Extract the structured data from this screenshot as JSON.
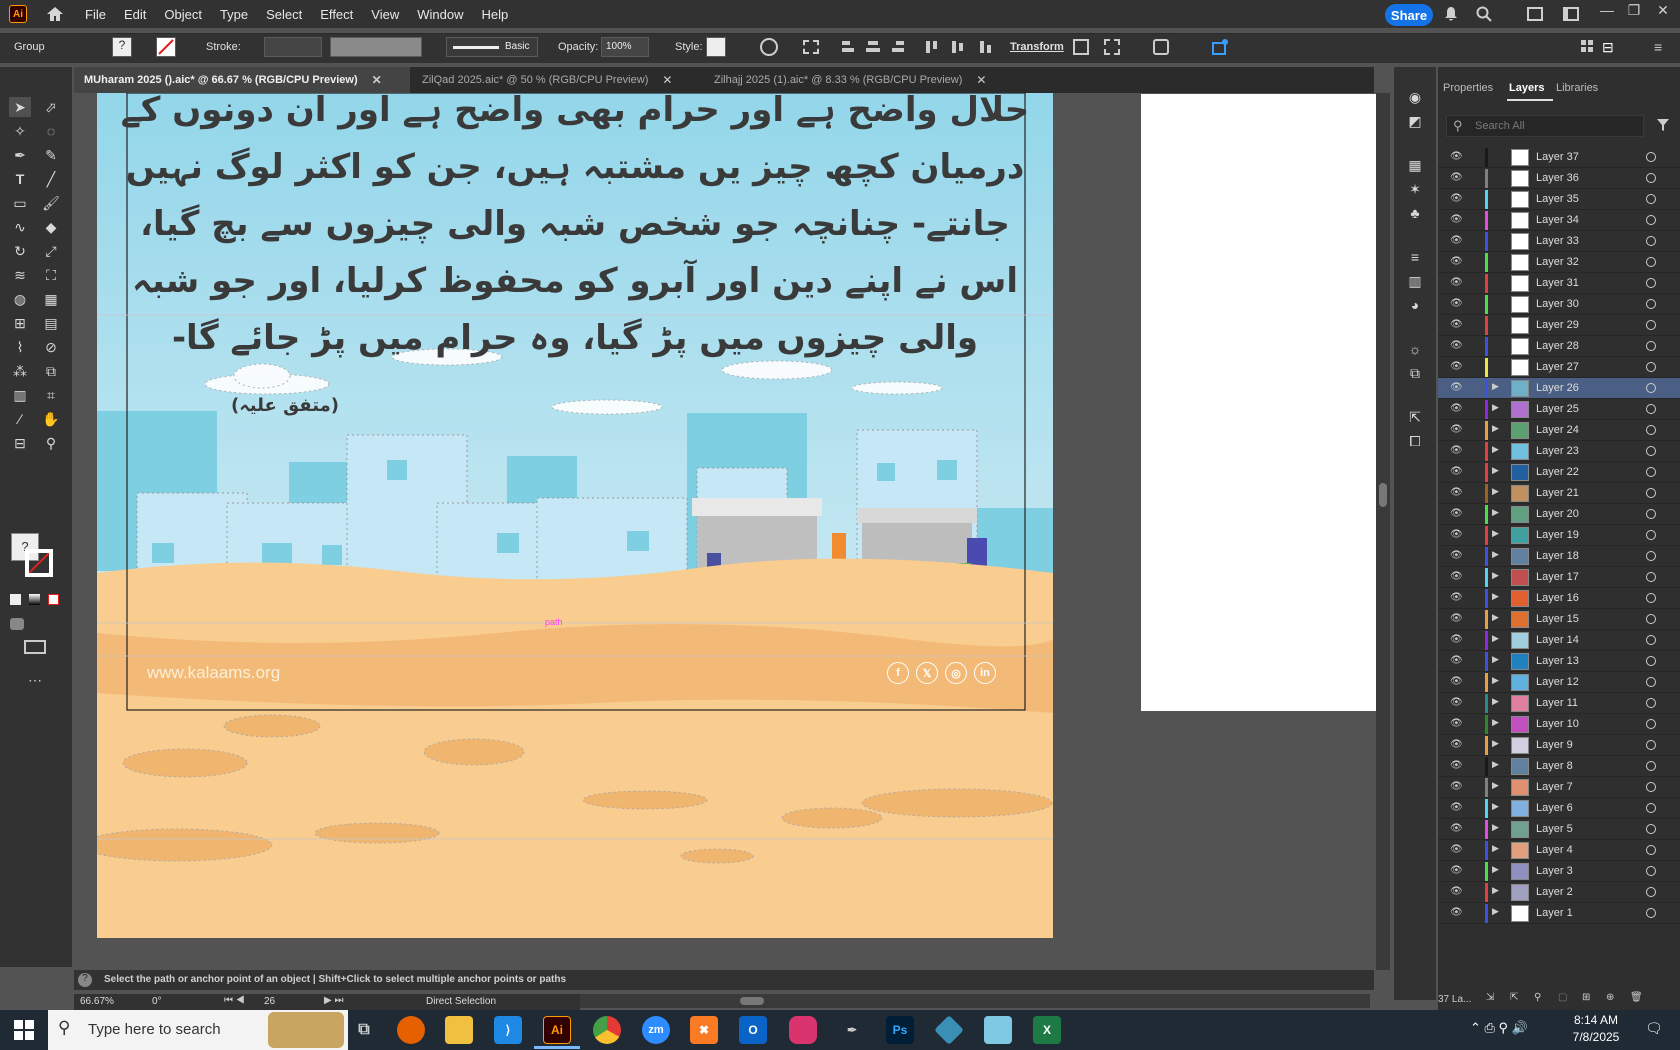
{
  "app": {
    "logo": "Ai",
    "icon": "home-icon"
  },
  "menu": [
    "File",
    "Edit",
    "Object",
    "Type",
    "Select",
    "Effect",
    "View",
    "Window",
    "Help"
  ],
  "share_label": "Share",
  "control": {
    "selection_label": "Group",
    "stroke_label": "Stroke:",
    "brush_label": "Basic",
    "opacity_label": "Opacity:",
    "opacity_value": "100%",
    "style_label": "Style:",
    "transform_label": "Transform"
  },
  "tabs": [
    {
      "label": "MUharam 2025 ().aic* @ 66.67 % (RGB/CPU Preview)",
      "active": true
    },
    {
      "label": "ZilQad 2025.aic* @ 50 % (RGB/CPU Preview)",
      "active": false
    },
    {
      "label": "Zilhajj 2025 (1).aic* @ 8.33 % (RGB/CPU Preview)",
      "active": false
    }
  ],
  "artwork": {
    "lines": [
      "حلال واضح ہے اور حرام بھی واضح ہے اور ان دونوں کے",
      "درمیان کچھ چیز یں مشتبہ ہیں، جن کو اکثر لوگ نہیں",
      "جانتے- چنانچہ جو شخص شبہ والی چیزوں سے بچ گیا،",
      "اس نے اپنے دین اور آبرو کو محفوظ کرلیا، اور جو شبہ",
      "والی چیزوں میں پڑ گیا، وہ حرام میں پڑ جائے گا-"
    ],
    "reference": "(متفق علیہ)",
    "website": "www.kalaams.org",
    "social": [
      "f",
      "𝕏",
      "◎",
      "in"
    ],
    "path_label": "path"
  },
  "status": {
    "hint": "Select the path or anchor point of an object  |  Shift+Click to select multiple anchor points or paths",
    "zoom": "66.67%",
    "rotation": "0°",
    "artboard": "26",
    "tool": "Direct Selection"
  },
  "panel": {
    "tabs": [
      "Properties",
      "Layers",
      "Libraries"
    ],
    "search_placeholder": "Search All",
    "footer": "37 La..."
  },
  "layers": [
    {
      "name": "Layer 37",
      "color": "#1a1a1a",
      "thumb": "#ffffff",
      "expand": false
    },
    {
      "name": "Layer 36",
      "color": "#808080",
      "thumb": "#ffffff",
      "expand": false
    },
    {
      "name": "Layer 35",
      "color": "#4fd6f0",
      "thumb": "#ffffff",
      "expand": false
    },
    {
      "name": "Layer 34",
      "color": "#e14de1",
      "thumb": "#ffffff",
      "expand": false
    },
    {
      "name": "Layer 33",
      "color": "#3d52e0",
      "thumb": "#ffffff",
      "expand": false
    },
    {
      "name": "Layer 32",
      "color": "#47e047",
      "thumb": "#ffffff",
      "expand": false
    },
    {
      "name": "Layer 31",
      "color": "#e04040",
      "thumb": "#ffffff",
      "expand": false
    },
    {
      "name": "Layer 30",
      "color": "#47e047",
      "thumb": "#ffffff",
      "expand": false
    },
    {
      "name": "Layer 29",
      "color": "#e04040",
      "thumb": "#ffffff",
      "expand": false
    },
    {
      "name": "Layer 28",
      "color": "#3d52e0",
      "thumb": "#ffffff",
      "expand": false
    },
    {
      "name": "Layer 27",
      "color": "#e8e840",
      "thumb": "#ffffff",
      "expand": false
    },
    {
      "name": "Layer 26",
      "color": "#3d52e0",
      "thumb": "#6fb0c8",
      "expand": true,
      "selected": true
    },
    {
      "name": "Layer 25",
      "color": "#8a2be2",
      "thumb": "#b070d0",
      "expand": true
    },
    {
      "name": "Layer 24",
      "color": "#e8a040",
      "thumb": "#5aa070",
      "expand": true
    },
    {
      "name": "Layer 23",
      "color": "#e04040",
      "thumb": "#70c0e0",
      "expand": true
    },
    {
      "name": "Layer 22",
      "color": "#e04040",
      "thumb": "#2060a0",
      "expand": true
    },
    {
      "name": "Layer 21",
      "color": "#a06020",
      "thumb": "#c09060",
      "expand": true
    },
    {
      "name": "Layer 20",
      "color": "#47e047",
      "thumb": "#60a080",
      "expand": true
    },
    {
      "name": "Layer 19",
      "color": "#e04040",
      "thumb": "#40a0a0",
      "expand": true
    },
    {
      "name": "Layer 18",
      "color": "#3d52e0",
      "thumb": "#6080a0",
      "expand": true
    },
    {
      "name": "Layer 17",
      "color": "#4fd6f0",
      "thumb": "#c05050",
      "expand": true
    },
    {
      "name": "Layer 16",
      "color": "#3d52e0",
      "thumb": "#e06030",
      "expand": true
    },
    {
      "name": "Layer 15",
      "color": "#e8a040",
      "thumb": "#e07030",
      "expand": true
    },
    {
      "name": "Layer 14",
      "color": "#8a2be2",
      "thumb": "#a0d0e0",
      "expand": true
    },
    {
      "name": "Layer 13",
      "color": "#3d52e0",
      "thumb": "#2080c0",
      "expand": true
    },
    {
      "name": "Layer 12",
      "color": "#e8a040",
      "thumb": "#60b0e0",
      "expand": true
    },
    {
      "name": "Layer 11",
      "color": "#2a8a8a",
      "thumb": "#e080a0",
      "expand": true
    },
    {
      "name": "Layer 10",
      "color": "#2a8a2a",
      "thumb": "#c050c0",
      "expand": true
    },
    {
      "name": "Layer 9",
      "color": "#e8a040",
      "thumb": "#d0d0e0",
      "expand": true
    },
    {
      "name": "Layer 8",
      "color": "#1a1a1a",
      "thumb": "#6080a0",
      "expand": true
    },
    {
      "name": "Layer 7",
      "color": "#808080",
      "thumb": "#e09070",
      "expand": true
    },
    {
      "name": "Layer 6",
      "color": "#4fd6f0",
      "thumb": "#80b0e0",
      "expand": true
    },
    {
      "name": "Layer 5",
      "color": "#e14de1",
      "thumb": "#70a090",
      "expand": true
    },
    {
      "name": "Layer 4",
      "color": "#3d52e0",
      "thumb": "#e0a080",
      "expand": true
    },
    {
      "name": "Layer 3",
      "color": "#47e047",
      "thumb": "#9090c0",
      "expand": true
    },
    {
      "name": "Layer 2",
      "color": "#e04040",
      "thumb": "#a0a0c0",
      "expand": true
    },
    {
      "name": "Layer 1",
      "color": "#3d52e0",
      "thumb": "#ffffff",
      "expand": true
    }
  ],
  "taskbar": {
    "search_placeholder": "Type here to search",
    "time": "8:14 AM",
    "date": "7/8/2025",
    "apps": [
      "firefox-icon",
      "file-explorer-icon",
      "vscode-icon",
      "illustrator-icon",
      "chrome-icon",
      "zoom-icon",
      "xampp-icon",
      "outlook-icon",
      "creative-cloud-icon",
      "pen-icon",
      "photoshop-icon",
      "app-icon",
      "app-icon",
      "excel-icon"
    ]
  },
  "colors": {
    "sky": "#a8dce9",
    "sand": "#f9cc8f",
    "sand_dark": "#f0b56f",
    "accent": "#1473e6"
  }
}
